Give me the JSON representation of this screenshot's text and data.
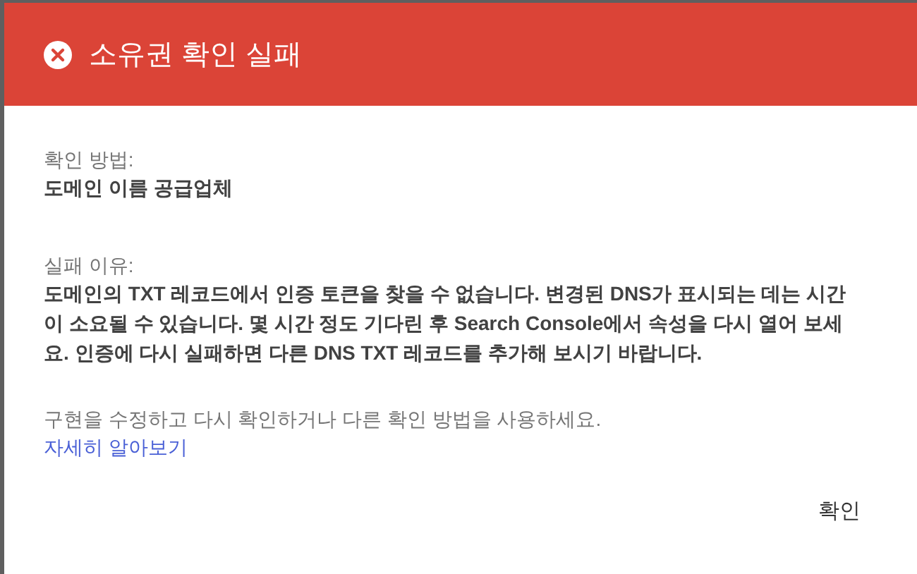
{
  "dialog": {
    "title": "소유권 확인 실패",
    "method": {
      "label": "확인 방법:",
      "value": "도메인 이름 공급업체"
    },
    "reason": {
      "label": "실패 이유:",
      "value": "도메인의 TXT 레코드에서 인증 토큰을 찾을 수 없습니다. 변경된 DNS가 표시되는 데는 시간이 소요될 수 있습니다. 몇 시간 정도 기다린 후 Search Console에서 속성을 다시 열어 보세요. 인증에 다시 실패하면 다른 DNS TXT 레코드를 추가해 보시기 바랍니다."
    },
    "hint": "구현을 수정하고 다시 확인하거나 다른 확인 방법을 사용하세요.",
    "link": "자세히 알아보기",
    "buttons": [
      "확인"
    ]
  }
}
